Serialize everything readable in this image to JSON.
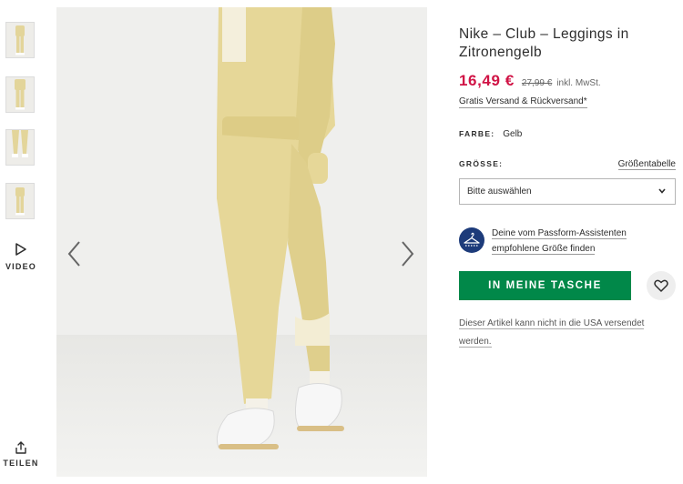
{
  "product": {
    "title": "Nike – Club – Leggings in Zitronengelb",
    "price_now": "16,49 €",
    "price_was": "27,99 €",
    "price_vat": "inkl. MwSt.",
    "shipping_link": "Gratis Versand & Rückversand*"
  },
  "colour": {
    "label": "FARBE:",
    "value": "Gelb"
  },
  "size": {
    "label": "GRÖSSE:",
    "guide_link": "Größentabelle",
    "select_value": "Bitte auswählen"
  },
  "fit_assistant": {
    "line1": "Deine vom Passform-Assistenten",
    "line2": "empfohlene Größe finden"
  },
  "actions": {
    "add_to_bag": "IN MEINE TASCHE"
  },
  "shipping_note": {
    "line1": "Dieser Artikel kann nicht in die USA versendet",
    "line2": "werden."
  },
  "rail": {
    "video_label": "VIDEO",
    "share_label": "TEILEN"
  },
  "colors": {
    "accent_green": "#018849",
    "price_red": "#d01345",
    "fit_icon_blue": "#1d3b7a",
    "legging_yellow": "#e6d798"
  },
  "icons": [
    "play-icon",
    "share-icon",
    "chevron-left-icon",
    "chevron-right-icon",
    "chevron-down-icon",
    "hanger-icon",
    "heart-icon"
  ]
}
